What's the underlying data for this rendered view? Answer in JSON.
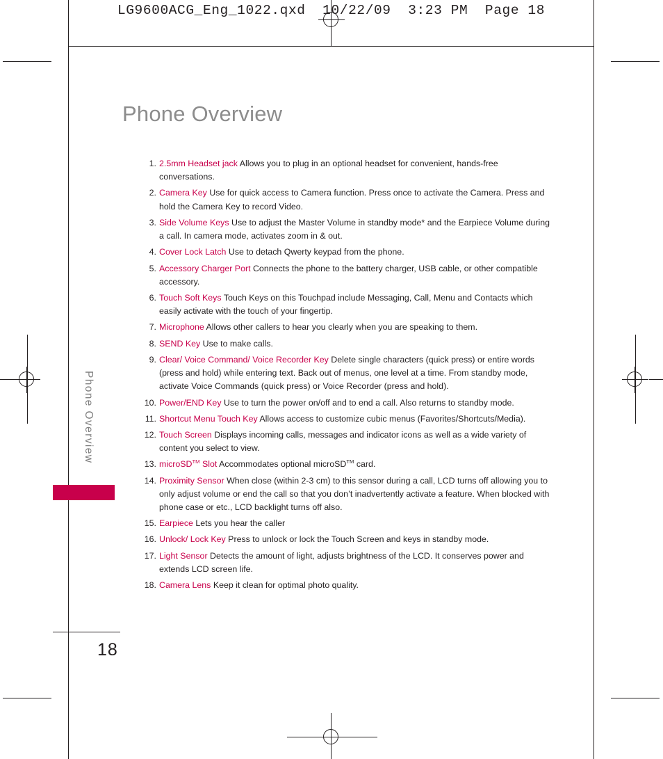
{
  "printer_header": "LG9600ACG_Eng_1022.qxd  10/22/09  3:23 PM  Page 18",
  "page": {
    "title": "Phone Overview",
    "running_head": "Phone Overview",
    "number": "18",
    "accent_color": "#c8004b",
    "title_color": "#8c8c8c"
  },
  "items": [
    {
      "num": "1.",
      "term": "2.5mm Headset jack",
      "desc": " Allows you to plug in an optional headset for convenient, hands-free conversations."
    },
    {
      "num": "2.",
      "term": "Camera Key",
      "desc": " Use for quick access to Camera function. Press once to activate the Camera. Press and hold the Camera Key to record Video."
    },
    {
      "num": "3.",
      "term": "Side Volume Keys",
      "desc": " Use to adjust the Master Volume in standby mode* and the Earpiece Volume during a call. In camera mode, activates zoom in & out."
    },
    {
      "num": "4.",
      "term": "Cover Lock Latch",
      "desc": "  Use to detach Qwerty keypad from the phone."
    },
    {
      "num": "5.",
      "term": "Accessory Charger Port",
      "desc": " Connects the phone to the battery charger, USB cable, or other compatible accessory."
    },
    {
      "num": "6.",
      "term": "Touch Soft Keys",
      "desc": " Touch Keys on this Touchpad include Messaging, Call, Menu and Contacts which easily activate with the touch of your fingertip."
    },
    {
      "num": "7.",
      "term": "Microphone",
      "desc": " Allows other callers to hear you clearly when you are speaking to them."
    },
    {
      "num": "8.",
      "term": "SEND Key",
      "desc": " Use to make calls."
    },
    {
      "num": "9.",
      "term": "Clear/ Voice Command/ Voice Recorder Key",
      "desc": " Delete single characters (quick press) or entire words (press and hold) while entering text. Back out of menus, one level at a time. From standby mode, activate Voice Commands (quick press) or Voice Recorder (press and hold)."
    },
    {
      "num": "10.",
      "term": "Power/END Key",
      "desc": " Use to turn the power on/off and to end a call. Also returns to standby mode."
    },
    {
      "num": "11.",
      "term": "Shortcut Menu Touch Key",
      "desc": " Allows access to customize cubic menus (Favorites/Shortcuts/Media)."
    },
    {
      "num": "12.",
      "term": "Touch Screen",
      "desc": " Displays incoming calls, messages and indicator icons as well as a wide variety of content you select to view."
    },
    {
      "num": "13.",
      "term": "microSD",
      "term_sup": "TM",
      "term_tail": " Slot",
      "desc": " Accommodates optional microSD",
      "desc_sup": "TM",
      "desc_tail": " card."
    },
    {
      "num": "14.",
      "term": "Proximity Sensor",
      "desc": " When close (within 2-3 cm) to this sensor during a call, LCD turns off allowing you to only adjust volume or end the call so that you don’t inadvertently activate a feature. When blocked with phone case or etc., LCD backlight turns off also."
    },
    {
      "num": "15.",
      "term": "Earpiece",
      "desc": " Lets you hear the caller"
    },
    {
      "num": "16.",
      "term": "Unlock/ Lock Key",
      "desc": " Press to unlock or lock the Touch Screen and keys in standby mode."
    },
    {
      "num": "17.",
      "term": " Light Sensor",
      "desc": " Detects the amount of light, adjusts brightness of the LCD. It conserves power and extends LCD screen life."
    },
    {
      "num": "18.",
      "term": "Camera Lens",
      "desc": " Keep it clean for optimal photo quality."
    }
  ]
}
